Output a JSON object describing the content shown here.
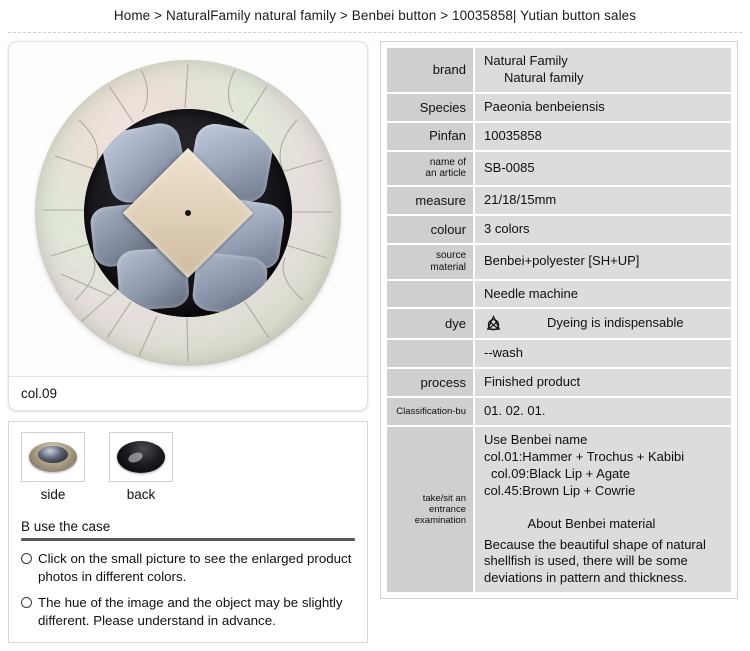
{
  "breadcrumb": {
    "text": "Home > NaturalFamily natural family > Benbei button > 10035858| Yutian button sales"
  },
  "product_image": {
    "caption": "col.09",
    "alt_name": "shell-button-col09"
  },
  "thumbnails": [
    {
      "label": "side",
      "name": "thumbnail-side"
    },
    {
      "label": "back",
      "name": "thumbnail-back"
    }
  ],
  "notes": {
    "title": "B use the case",
    "items": [
      "Click on the small picture to see the enlarged product photos in different colors.",
      "The hue of the image and the object may be slightly different. Please understand in advance."
    ]
  },
  "spec_table": {
    "rows": [
      {
        "key": "brand",
        "value": "Natural Family",
        "value2": "Natural family"
      },
      {
        "key": "Species",
        "value": "Paeonia benbeiensis"
      },
      {
        "key": "Pinfan",
        "value": "10035858"
      },
      {
        "key": "name of an article",
        "key_line1": "name of",
        "key_line2": "an article",
        "value": "SB-0085"
      },
      {
        "key": "measure",
        "value": "21/18/15mm"
      },
      {
        "key": "colour",
        "value": "3 colors"
      },
      {
        "key": "source material",
        "key_line1": "source",
        "key_line2": "material",
        "value": "Benbei+polyester [SH+UP]"
      },
      {
        "key": "",
        "value": "Needle machine"
      },
      {
        "key": "dye",
        "value": "Dyeing is indispensable",
        "icon": "no-bleach-icon"
      },
      {
        "key": "",
        "value": "--wash"
      },
      {
        "key": "process",
        "value": "Finished product"
      },
      {
        "key": "Classification-bu",
        "value": "01. 02. 01."
      }
    ],
    "exam": {
      "key_line1": "take/sit an",
      "key_line2": "entrance",
      "key_line3": "examination",
      "lines": [
        "Use Benbei name",
        "col.01:Hammer + Trochus + Kabibi",
        "col.09:Black Lip + Agate",
        "col.45:Brown Lip + Cowrie"
      ],
      "heading": "About Benbei material",
      "body": "Because the beautiful shape of natural shellfish is used, there will be some deviations in pattern and thickness."
    }
  },
  "colors": {
    "cell_key": "#cfcfcf",
    "cell_value": "#dcdcdc",
    "text": "#101010",
    "rule": "#5a5a5a"
  }
}
